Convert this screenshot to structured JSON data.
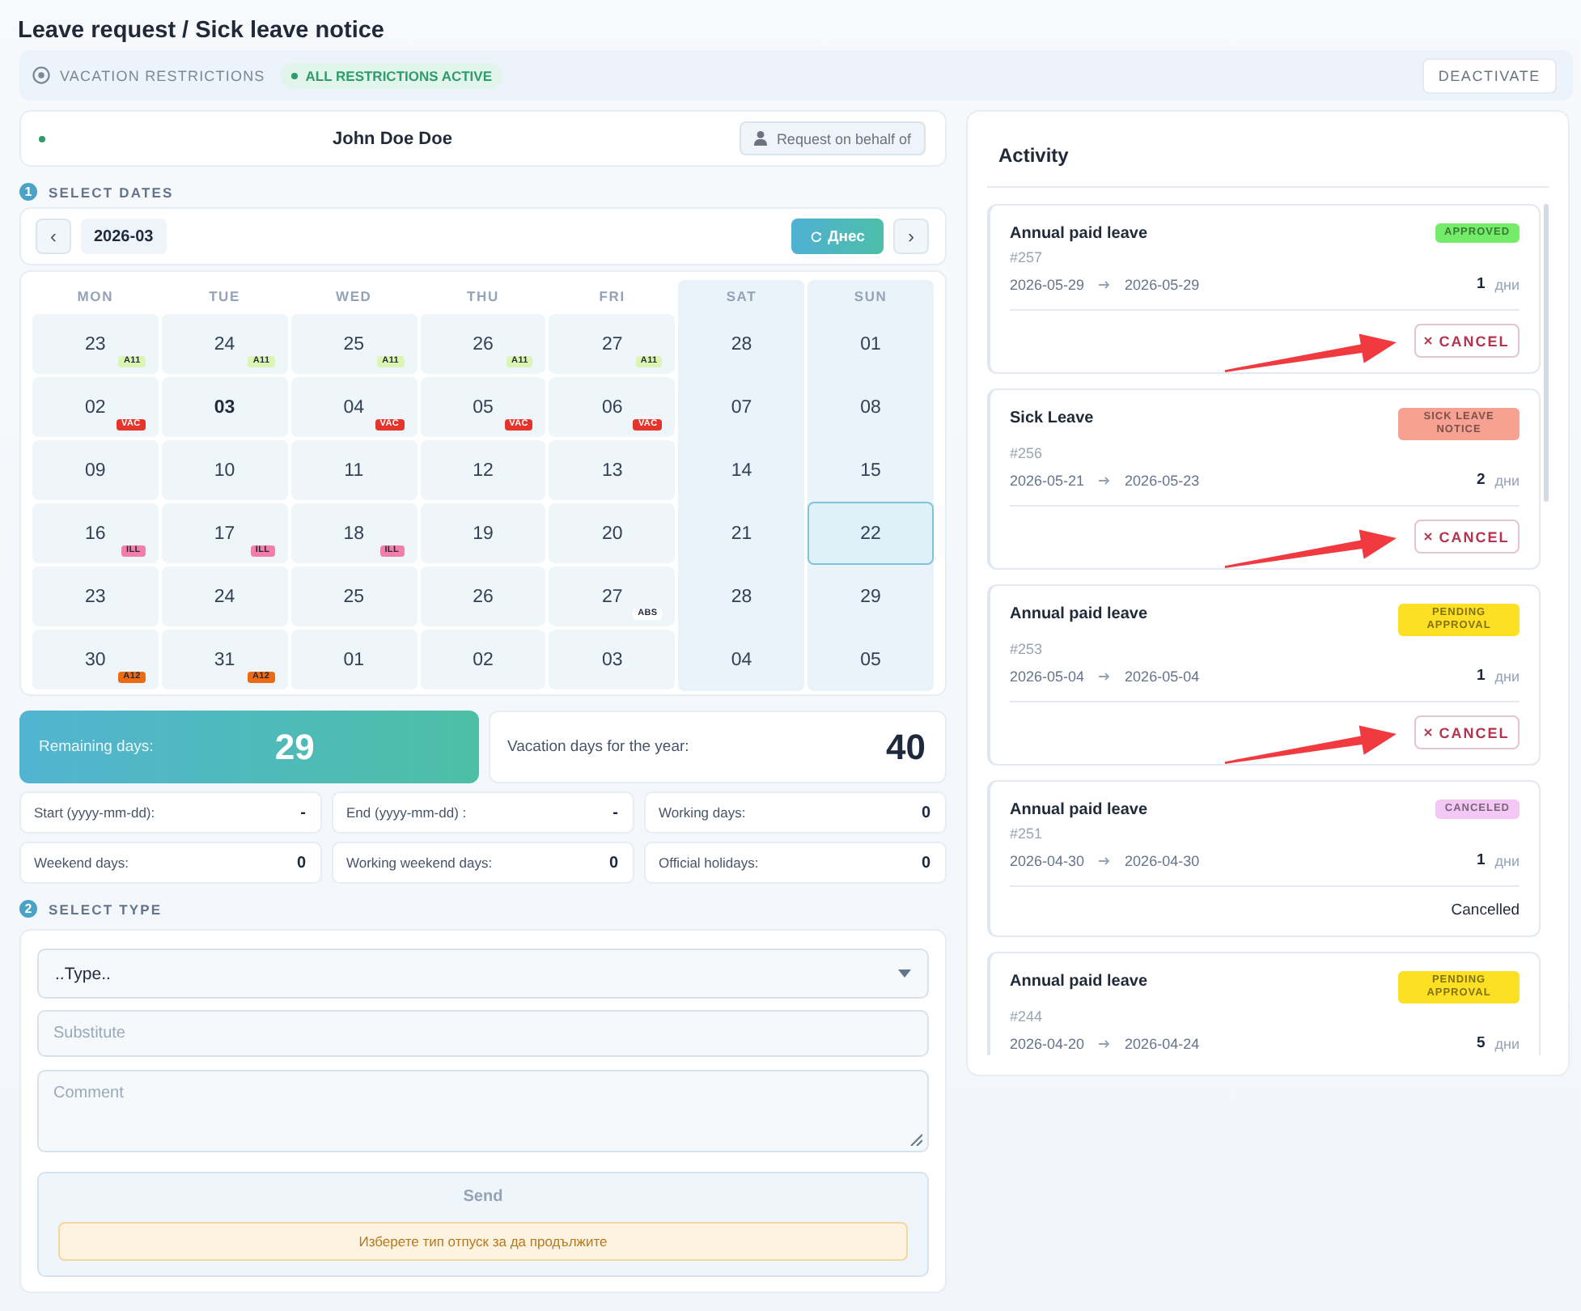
{
  "page": {
    "title": "Leave request / Sick leave notice"
  },
  "restrictions": {
    "label": "VACATION RESTRICTIONS",
    "active": true,
    "status": "ALL RESTRICTIONS ACTIVE",
    "button": "DEACTIVATE"
  },
  "employee": {
    "online": true,
    "name": "John Doe Doe",
    "button": "Request on behalf of"
  },
  "dates_section": {
    "step": "1",
    "title": "SELECT DATES"
  },
  "calendar": {
    "prev": "‹",
    "month": "2026-03",
    "today_button": "Днес",
    "next": "›",
    "weekdays": [
      {
        "label": "MON",
        "weekend": false
      },
      {
        "label": "TUE",
        "weekend": false
      },
      {
        "label": "WED",
        "weekend": false
      },
      {
        "label": "THU",
        "weekend": false
      },
      {
        "label": "FRI",
        "weekend": false
      },
      {
        "label": "SAT",
        "weekend": true
      },
      {
        "label": "SUN",
        "weekend": true
      }
    ],
    "weeks": [
      [
        {
          "day": "23",
          "selected": false,
          "today": false,
          "tag": {
            "label": "A11",
            "color": "#dcf5b4"
          }
        },
        {
          "day": "24",
          "selected": false,
          "today": false,
          "tag": {
            "label": "A11",
            "color": "#dcf5b4"
          }
        },
        {
          "day": "25",
          "selected": false,
          "today": false,
          "tag": {
            "label": "A11",
            "color": "#dcf5b4"
          }
        },
        {
          "day": "26",
          "selected": false,
          "today": false,
          "tag": {
            "label": "A11",
            "color": "#dcf5b4"
          }
        },
        {
          "day": "27",
          "selected": false,
          "today": false,
          "tag": {
            "label": "A11",
            "color": "#dcf5b4"
          }
        },
        {
          "day": "28",
          "selected": false,
          "today": false
        },
        {
          "day": "01",
          "selected": false,
          "today": false
        }
      ],
      [
        {
          "day": "02",
          "selected": false,
          "today": false,
          "tag": {
            "label": "VAC",
            "color": "#e4342c"
          }
        },
        {
          "day": "03",
          "selected": false,
          "today": true
        },
        {
          "day": "04",
          "selected": false,
          "today": false,
          "tag": {
            "label": "VAC",
            "color": "#e4342c"
          }
        },
        {
          "day": "05",
          "selected": false,
          "today": false,
          "tag": {
            "label": "VAC",
            "color": "#e4342c"
          }
        },
        {
          "day": "06",
          "selected": false,
          "today": false,
          "tag": {
            "label": "VAC",
            "color": "#e4342c"
          }
        },
        {
          "day": "07",
          "selected": false,
          "today": false
        },
        {
          "day": "08",
          "selected": false,
          "today": false
        }
      ],
      [
        {
          "day": "09",
          "selected": false,
          "today": false
        },
        {
          "day": "10",
          "selected": false,
          "today": false
        },
        {
          "day": "11",
          "selected": false,
          "today": false
        },
        {
          "day": "12",
          "selected": false,
          "today": false
        },
        {
          "day": "13",
          "selected": false,
          "today": false
        },
        {
          "day": "14",
          "selected": false,
          "today": false
        },
        {
          "day": "15",
          "selected": false,
          "today": false
        }
      ],
      [
        {
          "day": "16",
          "selected": false,
          "today": false,
          "tag": {
            "label": "ILL",
            "color": "#f27ea9"
          }
        },
        {
          "day": "17",
          "selected": false,
          "today": false,
          "tag": {
            "label": "ILL",
            "color": "#f27ea9"
          }
        },
        {
          "day": "18",
          "selected": false,
          "today": false,
          "tag": {
            "label": "ILL",
            "color": "#f27ea9"
          }
        },
        {
          "day": "19",
          "selected": false,
          "today": false
        },
        {
          "day": "20",
          "selected": false,
          "today": false
        },
        {
          "day": "21",
          "selected": false,
          "today": false
        },
        {
          "day": "22",
          "selected": true,
          "today": false
        }
      ],
      [
        {
          "day": "23",
          "selected": false,
          "today": false
        },
        {
          "day": "24",
          "selected": false,
          "today": false
        },
        {
          "day": "25",
          "selected": false,
          "today": false
        },
        {
          "day": "26",
          "selected": false,
          "today": false
        },
        {
          "day": "27",
          "selected": false,
          "today": false,
          "tag": {
            "label": "ABS",
            "color": "#ffffff"
          }
        },
        {
          "day": "28",
          "selected": false,
          "today": false
        },
        {
          "day": "29",
          "selected": false,
          "today": false
        }
      ],
      [
        {
          "day": "30",
          "selected": false,
          "today": false,
          "tag": {
            "label": "A12",
            "color": "#ec6a14"
          }
        },
        {
          "day": "31",
          "selected": false,
          "today": false,
          "tag": {
            "label": "A12",
            "color": "#ec6a14"
          }
        },
        {
          "day": "01",
          "selected": false,
          "today": false
        },
        {
          "day": "02",
          "selected": false,
          "today": false
        },
        {
          "day": "03",
          "selected": false,
          "today": false
        },
        {
          "day": "04",
          "selected": false,
          "today": false
        },
        {
          "day": "05",
          "selected": false,
          "today": false
        }
      ]
    ]
  },
  "summary": {
    "remaining": {
      "label": "Remaining days:",
      "value": "29"
    },
    "yearly": {
      "label": "Vacation days for the year:",
      "value": "40"
    }
  },
  "details": [
    {
      "label": "Start (yyyy-mm-dd):",
      "value": "-"
    },
    {
      "label": "End (yyyy-mm-dd) :",
      "value": "-"
    },
    {
      "label": "Working days:",
      "value": "0"
    },
    {
      "label": "Weekend days:",
      "value": "0"
    },
    {
      "label": "Working weekend days:",
      "value": "0"
    },
    {
      "label": "Official holidays:",
      "value": "0"
    }
  ],
  "type_section": {
    "step": "2",
    "title": "SELECT TYPE"
  },
  "form": {
    "type_select": {
      "value": "..Type.."
    },
    "substitute": {
      "placeholder": "Substitute"
    },
    "comment": {
      "placeholder": "Comment"
    },
    "send": {
      "label": "Send",
      "disabled": true
    },
    "warning": "Изберете тип отпуск за да продължите"
  },
  "activity": {
    "title": "Activity",
    "items": [
      {
        "title": "Annual paid leave",
        "status": {
          "label": "APPROVED",
          "color": "#74ec6a"
        },
        "number": "#257",
        "from": "2026-05-29",
        "to": "2026-05-29",
        "days": "1",
        "unit": "дни",
        "action": {
          "kind": "button",
          "label": "CANCEL"
        },
        "pointed_at": true
      },
      {
        "title": "Sick Leave",
        "status": {
          "label": "SICK LEAVE NOTICE",
          "color": "#f6a192"
        },
        "number": "#256",
        "from": "2026-05-21",
        "to": "2026-05-23",
        "days": "2",
        "unit": "дни",
        "action": {
          "kind": "button",
          "label": "CANCEL"
        },
        "pointed_at": true
      },
      {
        "title": "Annual paid leave",
        "status": {
          "label": "PENDING APPROVAL",
          "color": "#fde024"
        },
        "number": "#253",
        "from": "2026-05-04",
        "to": "2026-05-04",
        "days": "1",
        "unit": "дни",
        "action": {
          "kind": "button",
          "label": "CANCEL"
        },
        "pointed_at": true
      },
      {
        "title": "Annual paid leave",
        "status": {
          "label": "CANCELED",
          "color": "#f3c8f5"
        },
        "number": "#251",
        "from": "2026-04-30",
        "to": "2026-04-30",
        "days": "1",
        "unit": "дни",
        "action": {
          "kind": "text",
          "label": "Cancelled"
        },
        "pointed_at": false
      },
      {
        "title": "Annual paid leave",
        "status": {
          "label": "PENDING APPROVAL",
          "color": "#fde024"
        },
        "number": "#244",
        "from": "2026-04-20",
        "to": "2026-04-24",
        "days": "5",
        "unit": "дни",
        "pointed_at": false
      }
    ]
  }
}
